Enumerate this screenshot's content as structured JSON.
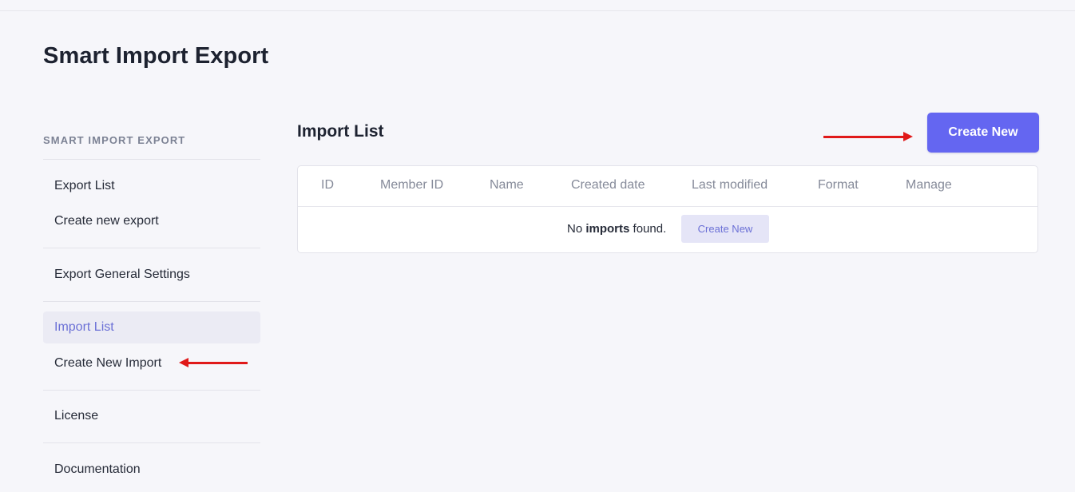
{
  "app": {
    "title": "Smart Import Export"
  },
  "sidebar": {
    "heading": "SMART IMPORT EXPORT",
    "items": [
      {
        "label": "Export List"
      },
      {
        "label": "Create new export"
      },
      {
        "label": "Export General Settings"
      },
      {
        "label": "Import List",
        "active": true
      },
      {
        "label": "Create New Import"
      },
      {
        "label": "License"
      },
      {
        "label": "Documentation"
      }
    ]
  },
  "main": {
    "title": "Import List",
    "create_button": "Create New",
    "table": {
      "columns": [
        "ID",
        "Member ID",
        "Name",
        "Created date",
        "Last modified",
        "Format",
        "Manage"
      ],
      "empty": {
        "prefix": "No ",
        "emphasis": "imports",
        "suffix": " found.",
        "button": "Create New"
      }
    }
  },
  "colors": {
    "accent": "#6466f1",
    "active_item": "#6b70d6",
    "annotation_arrow": "#e01919"
  },
  "icons": [
    "arrow-icon"
  ]
}
